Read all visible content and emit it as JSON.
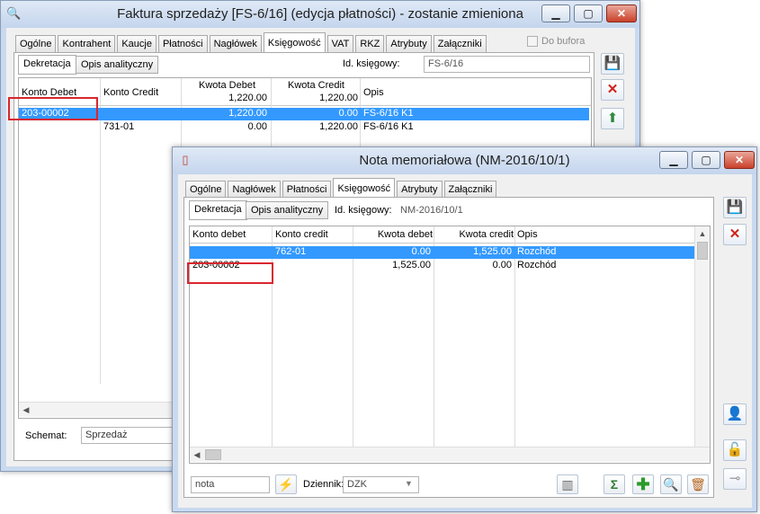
{
  "window1": {
    "title": "Faktura sprzedaży [FS-6/16] (edycja płatności) - zostanie zmieniona",
    "tabs": [
      "Ogólne",
      "Kontrahent",
      "Kaucje",
      "Płatności",
      "Nagłówek",
      "Księgowość",
      "VAT",
      "RKZ",
      "Atrybuty",
      "Załączniki"
    ],
    "active_tab": "Księgowość",
    "do_bufora_label": "Do bufora",
    "subtabs": [
      "Dekretacja",
      "Opis analityczny"
    ],
    "id_label": "Id. księgowy:",
    "id_value": "FS-6/16",
    "grid": {
      "headers": [
        "Konto Debet",
        "Konto Credit",
        "Kwota Debet",
        "Kwota Credit",
        "Opis"
      ],
      "totals": {
        "debet": "1,220.00",
        "credit": "1,220.00"
      },
      "rows": [
        {
          "debet_acc": "203-00002",
          "credit_acc": "",
          "debet": "1,220.00",
          "credit": "0.00",
          "opis": "FS-6/16 K1"
        },
        {
          "debet_acc": "",
          "credit_acc": "731-01",
          "debet": "0.00",
          "credit": "1,220.00",
          "opis": "FS-6/16 K1"
        }
      ]
    },
    "schemat_label": "Schemat:",
    "schemat_value": "Sprzedaż"
  },
  "window2": {
    "title": "Nota memoriałowa (NM-2016/10/1)",
    "tabs": [
      "Ogólne",
      "Nagłówek",
      "Płatności",
      "Księgowość",
      "Atrybuty",
      "Załączniki"
    ],
    "active_tab": "Księgowość",
    "subtabs": [
      "Dekretacja",
      "Opis analityczny"
    ],
    "id_label": "Id. księgowy:",
    "id_value": "NM-2016/10/1",
    "grid": {
      "headers": [
        "Konto debet",
        "Konto credit",
        "Kwota debet",
        "Kwota credit",
        "Opis"
      ],
      "rows": [
        {
          "debet_acc": "",
          "credit_acc": "762-01",
          "debet": "0.00",
          "credit": "1,525.00",
          "opis": "Rozchód"
        },
        {
          "debet_acc": "203-00002",
          "credit_acc": "",
          "debet": "1,525.00",
          "credit": "0.00",
          "opis": "Rozchód"
        }
      ]
    },
    "search_value": "nota",
    "dziennik_label": "Dziennik:",
    "dziennik_value": "DZK"
  },
  "colors": {
    "selection": "#3399ff",
    "highlight_box": "#d9262f"
  }
}
